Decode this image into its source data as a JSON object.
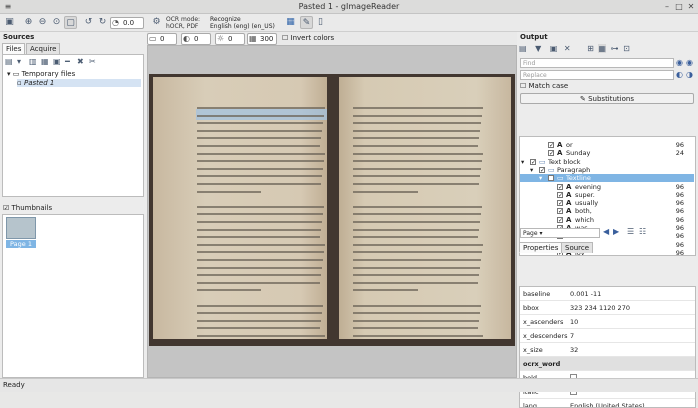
{
  "window": {
    "title": "Pasted 1 - gImageReader"
  },
  "toolbar": {
    "zoom_value": "0.0",
    "ocr_mode_label": "OCR mode:",
    "ocr_mode_value": "hOCR, PDF",
    "recognize_label": "Recognize",
    "language_value": "English (eng) (en_US)"
  },
  "viewer_tools": {
    "brightness": "0",
    "contrast": "0",
    "resolution": "300",
    "invert_label": "Invert colors"
  },
  "sources": {
    "header": "Sources",
    "tabs": [
      "Files",
      "Acquire"
    ],
    "tree": {
      "folder": "Temporary files",
      "item": "Pasted 1"
    },
    "thumbnails_label": "Thumbnails",
    "thumb_caption": "Page 1"
  },
  "output": {
    "header": "Output",
    "find_placeholder": "Find",
    "replace_placeholder": "Replace",
    "match_case_label": "Match case",
    "substitutions_label": "Substitutions",
    "rows": [
      {
        "kind": "word",
        "text": "or",
        "num": "96",
        "indent": 3
      },
      {
        "kind": "word",
        "text": "Sunday",
        "num": "24",
        "indent": 3
      },
      {
        "kind": "block",
        "text": "Text block",
        "num": "",
        "indent": 1
      },
      {
        "kind": "block",
        "text": "Paragraph",
        "num": "",
        "indent": 2
      },
      {
        "kind": "line",
        "text": "Textline",
        "num": "",
        "indent": 3,
        "selected": true
      },
      {
        "kind": "word",
        "text": "evening",
        "num": "96",
        "indent": 4
      },
      {
        "kind": "word",
        "text": "super.",
        "num": "96",
        "indent": 4
      },
      {
        "kind": "word",
        "text": "usually",
        "num": "96",
        "indent": 4
      },
      {
        "kind": "word",
        "text": "both,",
        "num": "96",
        "indent": 4
      },
      {
        "kind": "word",
        "text": "which",
        "num": "96",
        "indent": 4
      },
      {
        "kind": "word",
        "text": "was",
        "num": "96",
        "indent": 4
      },
      {
        "kind": "word",
        "text": "a",
        "num": "96",
        "indent": 4
      },
      {
        "kind": "word",
        "text": "great",
        "num": "96",
        "indent": 4
      },
      {
        "kind": "word",
        "text": "joy",
        "num": "96",
        "indent": 4
      }
    ],
    "page_select": "Page",
    "tabs": [
      "Properties",
      "Source"
    ],
    "properties": [
      {
        "key": "baseline",
        "value": "0.001 -11"
      },
      {
        "key": "bbox",
        "value": "323 234 1120 270"
      },
      {
        "key": "x_ascenders",
        "value": "10"
      },
      {
        "key": "x_descenders",
        "value": "7"
      },
      {
        "key": "x_size",
        "value": "32"
      },
      {
        "key": "ocrx_word",
        "value": "",
        "group": true
      },
      {
        "key": "bold",
        "value": "",
        "checkbox": true
      },
      {
        "key": "italic",
        "value": "",
        "checkbox": true
      },
      {
        "key": "lang",
        "value": "English (United States)"
      }
    ]
  },
  "status": {
    "text": "Ready"
  }
}
